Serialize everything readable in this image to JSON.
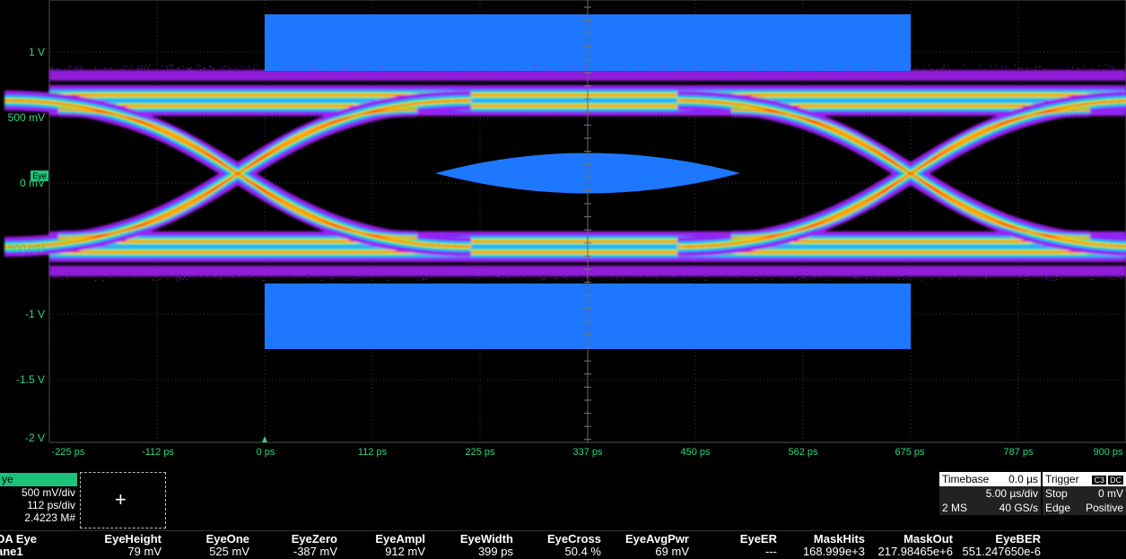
{
  "y_axis": [
    "1 V",
    "500 mV",
    "0 mV",
    "-500 mV",
    "-1 V",
    "-1.5 V",
    "-2 V"
  ],
  "x_axis": [
    "-225 ps",
    "-112 ps",
    "0 ps",
    "112 ps",
    "225 ps",
    "337 ps",
    "450 ps",
    "562 ps",
    "675 ps",
    "787 ps",
    "900 ps"
  ],
  "eye_marker": "Eye",
  "channel": {
    "tag": "ye",
    "vdiv": "500 mV/div",
    "hdiv": "112 ps/div",
    "count": "2.4223 M#"
  },
  "timebase": {
    "title": "Timebase",
    "delay": "0.0 µs",
    "tdiv": "5.00 µs/div",
    "samples": "2 MS",
    "rate": "40 GS/s"
  },
  "trigger": {
    "title": "Trigger",
    "ch_badge": "C3",
    "coupling_badge": "DC",
    "mode": "Stop",
    "level": "0 mV",
    "type": "Edge",
    "slope": "Positive"
  },
  "measurements": {
    "source_line1": "DA Eye",
    "source_line2": "ane1",
    "columns": [
      {
        "name": "EyeHeight",
        "value": "79 mV"
      },
      {
        "name": "EyeOne",
        "value": "525 mV"
      },
      {
        "name": "EyeZero",
        "value": "-387 mV"
      },
      {
        "name": "EyeAmpl",
        "value": "912 mV"
      },
      {
        "name": "EyeWidth",
        "value": "399 ps"
      },
      {
        "name": "EyeCross",
        "value": "50.4 %"
      },
      {
        "name": "EyeAvgPwr",
        "value": "69 mV"
      },
      {
        "name": "EyeER",
        "value": "---"
      },
      {
        "name": "MaskHits",
        "value": "168.999e+3"
      },
      {
        "name": "MaskOut",
        "value": "217.98465e+6"
      },
      {
        "name": "EyeBER",
        "value": "551.247650e-6"
      }
    ]
  },
  "colors": {
    "grid": "#3a3a3a",
    "axis_text": "#27d97e",
    "mask": "#1e78ff",
    "eye_hot": "#ff0000",
    "eye_warm": "#ffff00",
    "eye_mid": "#00e060",
    "eye_cool": "#00c8ff",
    "eye_cold": "#5a2cff",
    "eye_edge": "#a020f0"
  }
}
